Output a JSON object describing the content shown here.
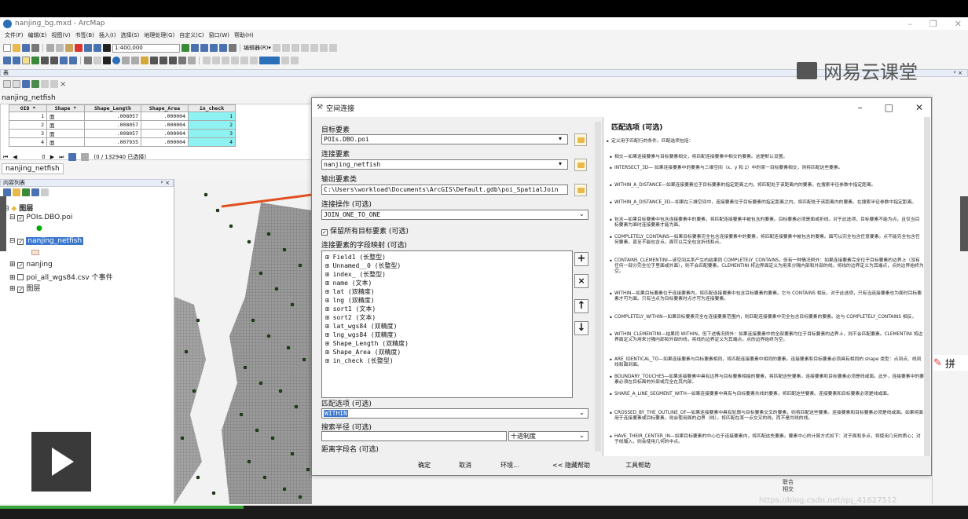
{
  "app": {
    "title": "nanjing_bg.mxd - ArcMap",
    "window_controls": [
      "–",
      "❐",
      "✕"
    ],
    "menu": [
      "文件(F)",
      "编辑(E)",
      "视图(V)",
      "书签(B)",
      "插入(I)",
      "选择(S)",
      "地理处理(G)",
      "自定义(C)",
      "窗口(W)",
      "帮助(H)"
    ],
    "scale": "1:400,000",
    "editor_label": "编辑器(R)▾"
  },
  "watermark": "网易云课堂",
  "table_panel": {
    "header": "表",
    "title": "nanjing_netfish",
    "columns": [
      "OID *",
      "Shape *",
      "Shape_Length",
      "Shape_Area",
      "in_check"
    ],
    "rows": [
      [
        "1",
        "面",
        ".008057",
        ".000004",
        "1"
      ],
      [
        "2",
        "面",
        ".008057",
        ".000004",
        "2"
      ],
      [
        "3",
        "面",
        ".008057",
        ".000004",
        "3"
      ],
      [
        "4",
        "面",
        ".007935",
        ".000004",
        "4"
      ]
    ],
    "nav": "0",
    "selection_status": "(0 / 132940 已选择)",
    "tab": "nanjing_netfish"
  },
  "toc": {
    "header": "内容列表",
    "layers_label": "图层",
    "items": [
      "POIs.DBO.poi",
      "nanjing_netfish",
      "nanjing",
      "poi_all_wgs84.csv 个事件",
      "图层"
    ]
  },
  "dialog": {
    "title": "空间连接",
    "target_label": "目标要素",
    "target_value": "POIs.DBO.poi",
    "join_label": "连接要素",
    "join_value": "nanjing_netfish",
    "output_label": "输出要素类",
    "output_value": "C:\\Users\\workload\\Documents\\ArcGIS\\Default.gdb\\poi_SpatialJoin",
    "operation_label": "连接操作 (可选)",
    "operation_value": "JOIN_ONE_TO_ONE",
    "keep_all_label": "保留所有目标要素 (可选)",
    "fieldmap_label": "连接要素的字段映射 (可选)",
    "fields": [
      "Field1 (长整型)",
      "Unnamed__0 (长整型)",
      "index_ (长整型)",
      "name (文本)",
      "lat (双精度)",
      "lng (双精度)",
      "sort1 (文本)",
      "sort2 (文本)",
      "lat_wgs84 (双精度)",
      "lng_wgs84 (双精度)",
      "Shape_Length (双精度)",
      "Shape_Area (双精度)",
      "in_check (长整型)"
    ],
    "match_label": "匹配选项 (可选)",
    "match_value": "WITHIN",
    "radius_label": "搜索半径 (可选)",
    "radius_unit": "十进制度",
    "distance_label": "距离字段名 (可选)",
    "buttons": {
      "ok": "确定",
      "cancel": "取消",
      "env": "环境...",
      "hide_help": "<< 隐藏帮助",
      "tool_help": "工具帮助"
    }
  },
  "help": {
    "title": "匹配选项 (可选)",
    "intro": "定义用于匹配行的条件。匹配选项包括：",
    "items": [
      "相交—如果连接要素与目标要素相交，将匹配连接要素中相交的要素。这是默认设置。",
      "INTERSECT_3D— 如果连接要素中的要素与三维空间（x、y 和 z）中的某一目标要素相交，则将匹配这些要素。",
      "WITHIN_A_DISTANCE—如果连接要素位于目标要素的指定距离之内，将匹配处于该距离内的要素。在搜索半径参数中指定距离。",
      "WITHIN_A_DISTANCE_3D—如果在三维空间中，连接要素位于目标要素的指定距离之内，将匹配处于该距离内的要素。在搜索半径参数中指定距离。",
      "包含—如果目标要素中包含连接要素中的要素，将匹配连接要素中被包含的要素。目标要素必须是面或折线。对于此选项，目标要素不能为点，且仅当目标要素为面时连接要素才能为面。",
      "COMPLETELY_CONTAINS—如果目标要素完全包含连接要素中的要素，将匹配连接要素中被包含的要素。面可以完全包含任意要素。点不能完全包含任何要素，甚至不能包含点。面可以完全包含折线和点。",
      "CONTAINS_CLEMENTINI—该空间关系产生的结果同 COMPLETELY_CONTAINS，但有一种情况例外：如果连接要素完全位于目标要素的边界上（没有任何一部分完全位于里面或外面），则不会匹配要素。CLEMENTINI 将边界面定义为用来分隔内部和外部的线，将线的边界定义为其端点，点的边界始终为空。",
      "WITHIN—如果目标要素位于连接要素内，将匹配连接要素中包含目标要素的要素。它与 CONTAINS 相反。对于此选项，只有当连接要素也为面时目标要素才可为面。只有当点为目标要素时点才可为连接要素。",
      "COMPLETELY_WITHIN—如果目标要素完全在连接要素范围内，则匹配连接要素中完全包含目标要素的要素。这与 COMPLETELY_CONTAINS 相反。",
      "WITHIN_CLEMENTINI—结果同 WITHIN，但下述情况例外：如果连接要素中的全部要素均位于目标要素的边界上，则不会匹配要素。CLEMENTINI 将边界面定义为用来分隔内部和外部的线，将线的边界定义为其端点，点的边界始终为空。",
      "ARE_IDENTICAL_TO—如果连接要素与目标要素相同，将匹配连接要素中相同的要素。连接要素和目标要素必须具有相同的 shape 类型：点到点、线到线和面到面。",
      "BOUNDARY_TOUCHES—如果连接要素中具有边界与目标要素相接的要素，将匹配这些要素。连接要素和目标要素必须是线或面。此外，连接要素中的要素必须在目标面的外部或完全在其内部。",
      "SHARE_A_LINE_SEGMENT_WITH—如果连接要素中具有与目标要素共线的要素，将匹配这些要素。连接要素和目标要素必须是线或面。",
      "CROSSED_BY_THE_OUTLINE_OF—如果连接要素中具有轮廓与目标要素交叉的要素，则将匹配这些要素。连接要素和目标要素必须是线或面。如果将面用于连接要素或目标要素，则会使用面的边界（线）。将匹配在某一点交叉的线，而不是共线的线。",
      "HAVE_THEIR_CENTER_IN—如果目标要素的中心位于连接要素内，将匹配这些要素。要素中心的计算方式如下：对于面和多点，将使用几何的质心；对于线输入，则会使用几何的中点。"
    ]
  },
  "side_panel": {
    "item1": "联合",
    "item2": "相交"
  },
  "overlay": {
    "pinyin": "拼",
    "url": "https://blog.csdn.net/qq_41627512"
  }
}
